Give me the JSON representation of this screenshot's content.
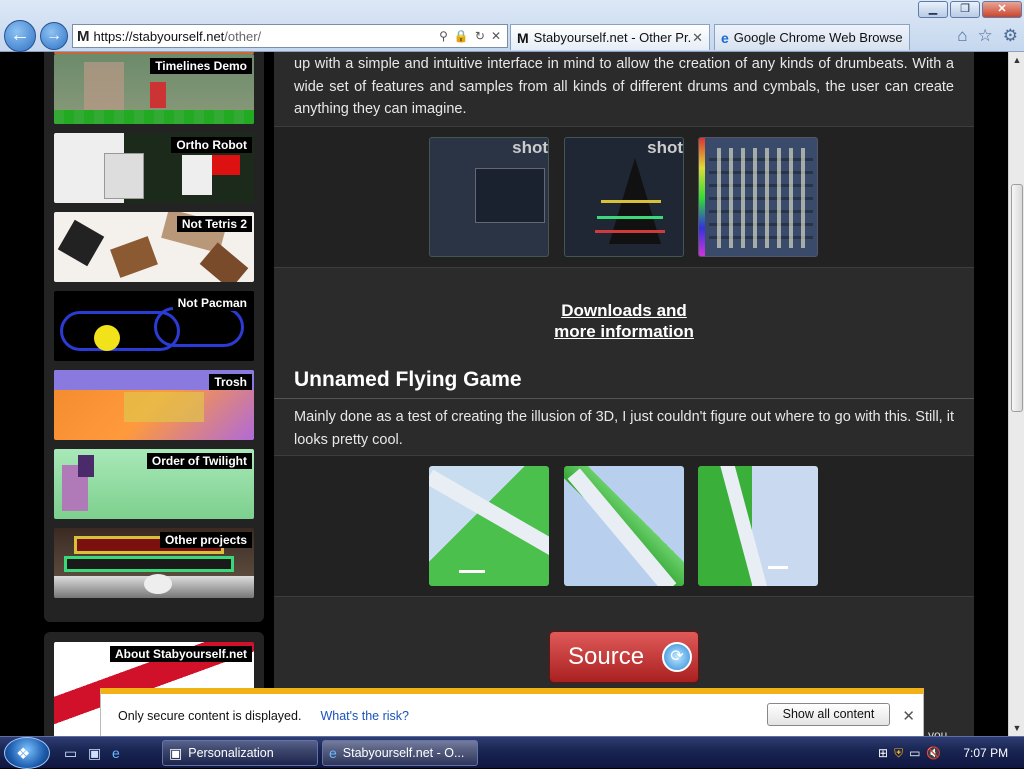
{
  "browser": {
    "url_main": "https://stabyourself.net",
    "url_path": "/other/",
    "window_controls": {
      "minimize": "▁",
      "restore": "❐",
      "close": "✕"
    },
    "tabs": [
      {
        "label": "Stabyourself.net - Other Pr...",
        "icon": "M"
      },
      {
        "label": "Google Chrome Web Browser",
        "icon": "e"
      }
    ]
  },
  "sidebar": {
    "items": [
      {
        "label": "Timelines Demo"
      },
      {
        "label": "Ortho Robot"
      },
      {
        "label": "Not Tetris 2"
      },
      {
        "label": "Not Pacman"
      },
      {
        "label": "Trosh"
      },
      {
        "label": "Order of Twilight"
      },
      {
        "label": "Other projects"
      }
    ],
    "about": "About Stabyourself.net"
  },
  "content": {
    "intro_text": "up with a simple and intuitive interface in mind to allow the creation of any kinds of drumbeats. With a wide set of features and samples from all kinds of different drums and cymbals, the user can create anything they can imagine.",
    "shot_overlay": "shot",
    "downloads_line1": "Downloads and",
    "downloads_line2": "more information",
    "section_title": "Unnamed Flying Game",
    "section_text": "Mainly done as a test of creating the illusion of 3D, I just couldn't figure out where to go with this. Still, it looks pretty cool.",
    "source_button": "Source",
    "partial_text": "you"
  },
  "infobar": {
    "message": "Only secure content is displayed.",
    "risk_link": "What's the risk?",
    "button": "Show all content"
  },
  "taskbar": {
    "items": [
      {
        "label": "Personalization"
      },
      {
        "label": "Stabyourself.net - O..."
      }
    ],
    "time": "7:07 PM"
  }
}
